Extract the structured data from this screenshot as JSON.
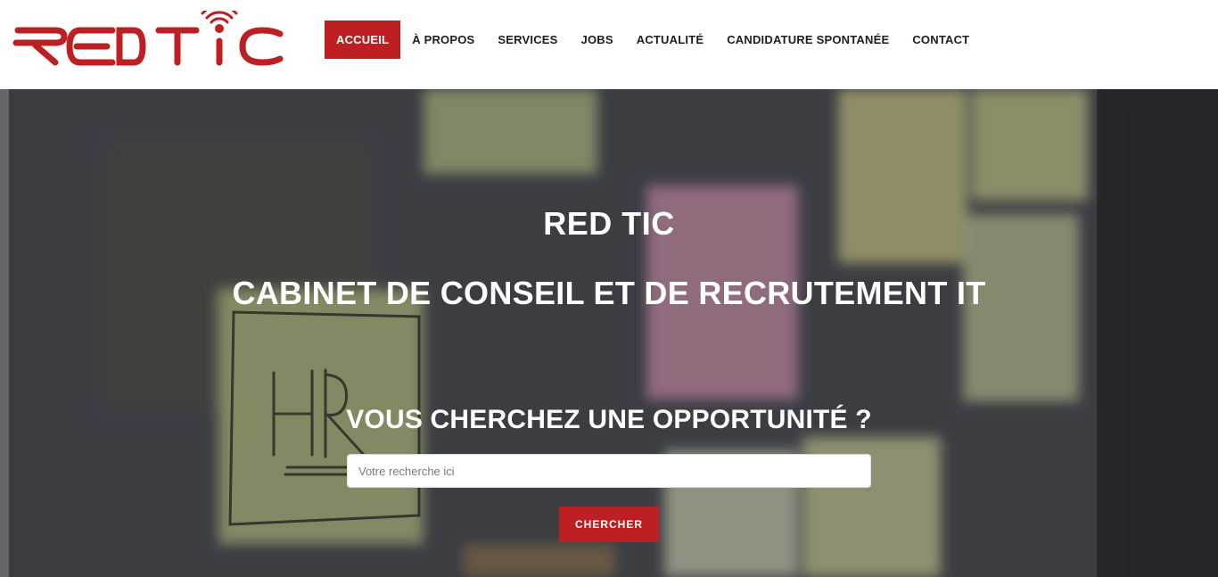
{
  "logo": {
    "text": "RED TIC",
    "icon": "antenna-signal-icon",
    "color": "#bd1f23"
  },
  "nav": {
    "items": [
      {
        "label": "ACCUEIL",
        "active": true
      },
      {
        "label": "À PROPOS",
        "active": false
      },
      {
        "label": "SERVICES",
        "active": false
      },
      {
        "label": "JOBS",
        "active": false
      },
      {
        "label": "ACTUALITÉ",
        "active": false
      },
      {
        "label": "CANDIDATURE SPONTANÉE",
        "active": false
      },
      {
        "label": "CONTACT",
        "active": false
      }
    ]
  },
  "hero": {
    "title": "RED TIC",
    "subtitle": "CABINET DE CONSEIL ET DE RECRUTEMENT IT",
    "search_title": "VOUS CHERCHEZ UNE OPPORTUNITÉ ?",
    "search_placeholder": "Votre recherche ici",
    "search_value": "",
    "search_button": "CHERCHER",
    "background_image": "blurred-sticky-notes-hr"
  },
  "colors": {
    "accent": "#bd1f23",
    "text_dark": "#1d1d1d",
    "white": "#ffffff"
  }
}
